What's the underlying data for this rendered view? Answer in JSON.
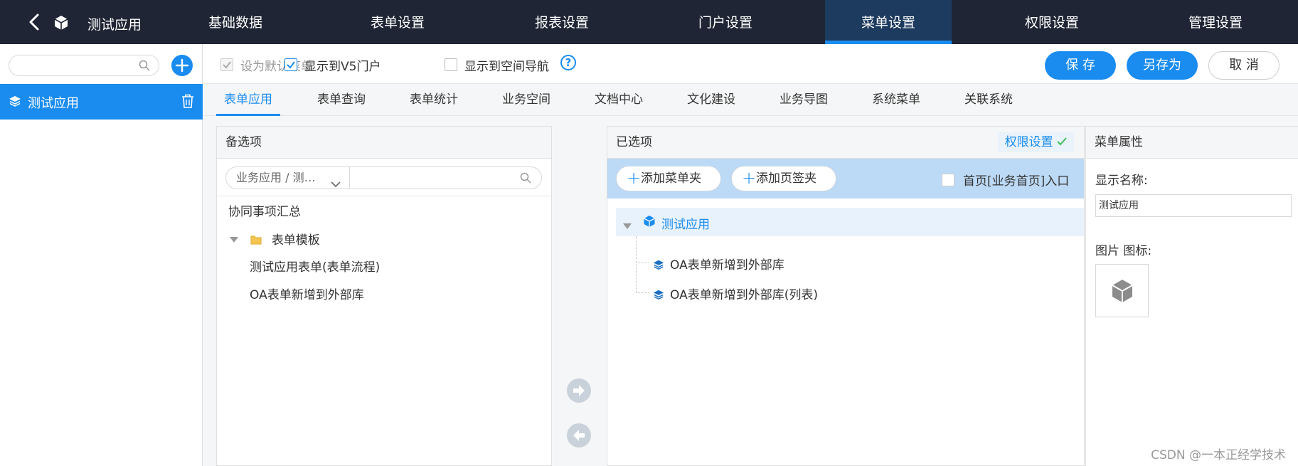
{
  "app": {
    "title": "测试应用"
  },
  "nav": {
    "tabs": [
      "基础数据",
      "表单设置",
      "报表设置",
      "门户设置",
      "菜单设置",
      "权限设置",
      "管理设置"
    ],
    "active_index": 4
  },
  "sidebar": {
    "search": {
      "placeholder": "",
      "value": ""
    },
    "items": [
      {
        "label": "测试应用",
        "selected": true
      }
    ]
  },
  "toolbar": {
    "default_menu": {
      "label": "设为默认菜单",
      "checked": true,
      "disabled": true
    },
    "show_v5_portal": {
      "label": "显示到V5门户",
      "checked": true
    },
    "show_space_nav": {
      "label": "显示到空间导航",
      "checked": false
    },
    "help_glyph": "?",
    "save_label": "保 存",
    "save_as_label": "另存为",
    "cancel_label": "取 消"
  },
  "subtabs": {
    "items": [
      "表单应用",
      "表单查询",
      "表单统计",
      "业务空间",
      "文档中心",
      "文化建设",
      "业务导图",
      "系统菜单",
      "关联系统"
    ],
    "active_index": 0
  },
  "candidates": {
    "title": "备选项",
    "filter": {
      "selected": "业务应用 / 测…",
      "placeholder": "",
      "value": ""
    },
    "tree": {
      "summary": "协同事项汇总",
      "folder": "表单模板",
      "items": [
        "测试应用表单(表单流程)",
        "OA表单新增到外部库"
      ]
    }
  },
  "selected": {
    "title": "已选项",
    "permission_label": "权限设置",
    "add_folder_label": "添加菜单夹",
    "add_tab_label": "添加页签夹",
    "home_entry": {
      "label": "首页[业务首页]入口",
      "checked": false
    },
    "root": "测试应用",
    "children": [
      "OA表单新增到外部库",
      "OA表单新增到外部库(列表)"
    ]
  },
  "properties": {
    "title": "菜单属性",
    "display_name_label": "显示名称:",
    "display_name_value": "测试应用",
    "icon_label": "图片 图标:"
  },
  "watermark": "CSDN @一本正经学技术",
  "colors": {
    "accent": "#1a8cf0",
    "topbar": "#1f2534",
    "active_nav": "#1d3a5f",
    "add_bar": "#bcd9f5"
  }
}
